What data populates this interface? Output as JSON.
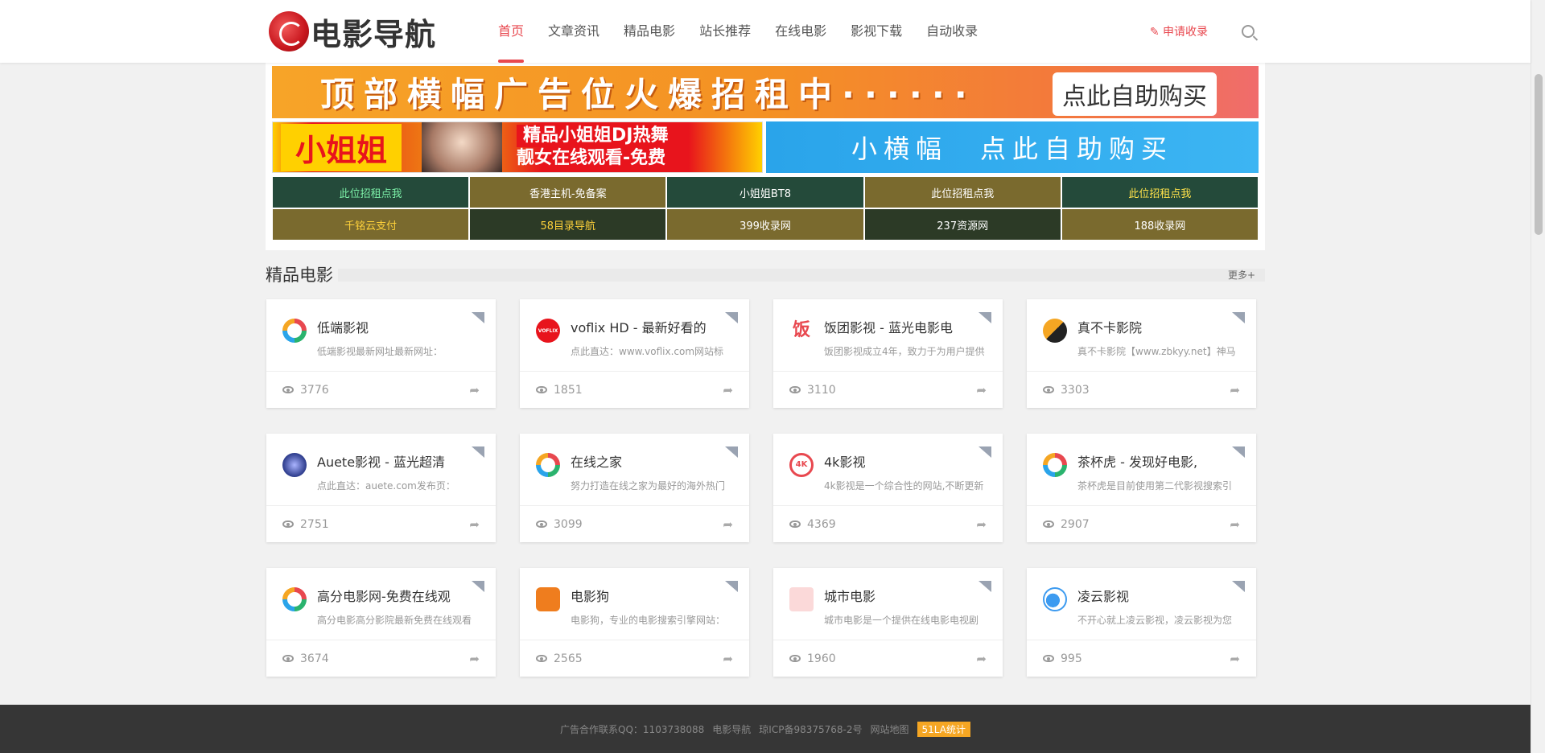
{
  "header": {
    "logo_text": "电影导航",
    "nav": [
      "首页",
      "文章资讯",
      "精品电影",
      "站长推荐",
      "在线电影",
      "影视下载",
      "自动收录"
    ],
    "apply_label": "✎ 申请收录"
  },
  "ads": {
    "top_banner_text": "顶部横幅广告位火爆招租中······",
    "top_banner_button": "点此自助购买",
    "girl_name": "小姐姐",
    "girl_line1": "精品小姐姐DJ热舞",
    "girl_line2": "靓女在线观看-免费",
    "small_banner_text": "小横幅　点此自助购买",
    "links": [
      {
        "label": "此位招租点我",
        "bg": "#244a3a",
        "color": "#7cf0a8"
      },
      {
        "label": "香港主机-免备案",
        "bg": "#7a6a2e",
        "color": "#ffffff"
      },
      {
        "label": "小姐姐BT8",
        "bg": "#244a3a",
        "color": "#ffffff"
      },
      {
        "label": "此位招租点我",
        "bg": "#7a6a2e",
        "color": "#ffffff"
      },
      {
        "label": "此位招租点我",
        "bg": "#244a3a",
        "color": "#ffe24a"
      },
      {
        "label": "千铭云支付",
        "bg": "#7a6a2e",
        "color": "#ffd23a"
      },
      {
        "label": "58目录导航",
        "bg": "#2c3a26",
        "color": "#ffd23a"
      },
      {
        "label": "399收录网",
        "bg": "#7a6a2e",
        "color": "#ffffff"
      },
      {
        "label": "237资源网",
        "bg": "#2c3a26",
        "color": "#ffffff"
      },
      {
        "label": "188收录网",
        "bg": "#7a6a2e",
        "color": "#ffffff"
      }
    ]
  },
  "section": {
    "title": "精品电影",
    "more": "更多+"
  },
  "cards": [
    {
      "title": "低端影视",
      "desc": "低端影视最新网址最新网址：",
      "views": "3776",
      "icon": "ring-icon"
    },
    {
      "title": "voflix HD - 最新好看的",
      "desc": "点此直达：www.voflix.com网站标",
      "views": "1851",
      "icon": "voflix-icon"
    },
    {
      "title": "饭团影视 - 蓝光电影电",
      "desc": "饭团影视成立4年，致力于为用户提供",
      "views": "3110",
      "icon": "fan-icon"
    },
    {
      "title": "真不卡影院",
      "desc": "真不卡影院【www.zbkyy.net】神马",
      "views": "3303",
      "icon": "s-logo-icon"
    },
    {
      "title": "Auete影视 - 蓝光超清",
      "desc": "点此直达：auete.com发布页：",
      "views": "2751",
      "icon": "auete-icon"
    },
    {
      "title": "在线之家",
      "desc": "努力打造在线之家为最好的海外热门",
      "views": "3099",
      "icon": "ring-icon"
    },
    {
      "title": "4k影视",
      "desc": "4k影视是一个综合性的网站,不断更新",
      "views": "4369",
      "icon": "4k-icon"
    },
    {
      "title": "茶杯虎 - 发现好电影,",
      "desc": "茶杯虎是目前使用第二代影视搜索引",
      "views": "2907",
      "icon": "ring-icon"
    },
    {
      "title": "高分电影网-免费在线观",
      "desc": "高分电影高分影院最新免费在线观看",
      "views": "3674",
      "icon": "ring-icon"
    },
    {
      "title": "电影狗",
      "desc": "电影狗，专业的电影搜索引擎网站：",
      "views": "2565",
      "icon": "dog-icon"
    },
    {
      "title": "城市电影",
      "desc": "城市电影是一个提供在线电影电视剧",
      "views": "1960",
      "icon": "city-icon"
    },
    {
      "title": "凌云影视",
      "desc": "不开心就上凌云影视，凌云影视为您",
      "views": "995",
      "icon": "cloud-icon"
    }
  ],
  "footer": {
    "items": [
      "广告合作联系QQ：1103738088",
      "电影导航",
      "琼ICP备98375768-2号",
      "网站地图"
    ],
    "badge": "51LA统计"
  },
  "colors": {
    "accent": "#e8484f"
  }
}
